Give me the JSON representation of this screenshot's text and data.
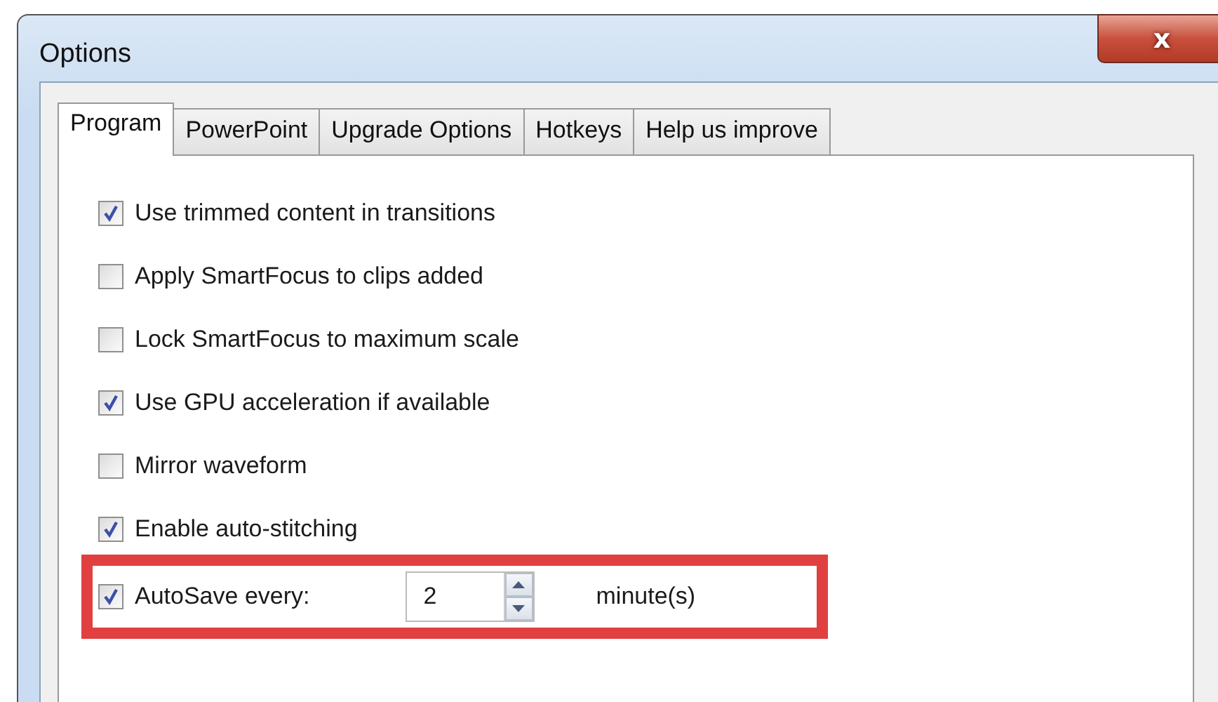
{
  "window": {
    "title": "Options",
    "close_icon": "x"
  },
  "tabs": [
    {
      "label": "Program",
      "selected": true
    },
    {
      "label": "PowerPoint",
      "selected": false
    },
    {
      "label": "Upgrade Options",
      "selected": false
    },
    {
      "label": "Hotkeys",
      "selected": false
    },
    {
      "label": "Help us improve",
      "selected": false
    }
  ],
  "options": [
    {
      "kind": "checkbox",
      "label": "Use trimmed content in transitions",
      "checked": true
    },
    {
      "kind": "checkbox",
      "label": "Apply SmartFocus to clips added",
      "checked": false
    },
    {
      "kind": "checkbox",
      "label": "Lock SmartFocus to maximum scale",
      "checked": false
    },
    {
      "kind": "checkbox",
      "label": "Use GPU acceleration if available",
      "checked": true
    },
    {
      "kind": "checkbox",
      "label": "Mirror waveform",
      "checked": false
    },
    {
      "kind": "checkbox",
      "label": "Enable auto-stitching",
      "checked": true
    },
    {
      "kind": "spin",
      "label": "AutoSave every:",
      "checked": true,
      "value": "2",
      "unit": "minute(s)",
      "highlighted": true
    }
  ]
}
